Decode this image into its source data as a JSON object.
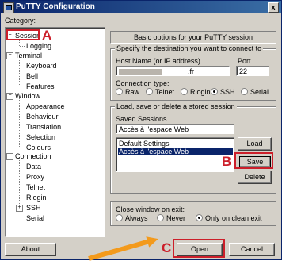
{
  "window": {
    "title": "PuTTY Configuration",
    "close_glyph": "x"
  },
  "category_label": "Category:",
  "tree": {
    "session": "Session",
    "logging": "Logging",
    "terminal": "Terminal",
    "keyboard": "Keyboard",
    "bell": "Bell",
    "features": "Features",
    "window": "Window",
    "appearance": "Appearance",
    "behaviour": "Behaviour",
    "translation": "Translation",
    "selection": "Selection",
    "colours": "Colours",
    "connection": "Connection",
    "data": "Data",
    "proxy": "Proxy",
    "telnet": "Telnet",
    "rlogin": "Rlogin",
    "ssh": "SSH",
    "serial": "Serial",
    "expanded_glyph": "−",
    "collapsed_glyph": "+"
  },
  "panel_header": "Basic options for your PuTTY session",
  "destination": {
    "group_title": "Specify the destination you want to connect to",
    "host_label": "Host Name (or IP address)",
    "host_value_suffix": ".fr",
    "port_label": "Port",
    "port_value": "22",
    "conn_type_label": "Connection type:",
    "conn_types": [
      "Raw",
      "Telnet",
      "Rlogin",
      "SSH",
      "Serial"
    ],
    "conn_type_selected": "SSH"
  },
  "sessions": {
    "group_title": "Load, save or delete a stored session",
    "saved_label": "Saved Sessions",
    "name_value": "Accès à l'espace Web",
    "list": [
      "Default Settings",
      "Accès à l'espace Web"
    ],
    "selected_index": 1,
    "load_label": "Load",
    "save_label": "Save",
    "delete_label": "Delete"
  },
  "close_on_exit": {
    "label": "Close window on exit:",
    "options": [
      "Always",
      "Never",
      "Only on clean exit"
    ],
    "selected": "Only on clean exit"
  },
  "buttons": {
    "about": "About",
    "open": "Open",
    "cancel": "Cancel"
  },
  "annotations": {
    "a": "A",
    "b": "B",
    "c": "C"
  },
  "colors": {
    "annotation_red": "#cc1f2a",
    "arrow_orange": "#f39a1c",
    "selection_blue": "#0a246a"
  }
}
